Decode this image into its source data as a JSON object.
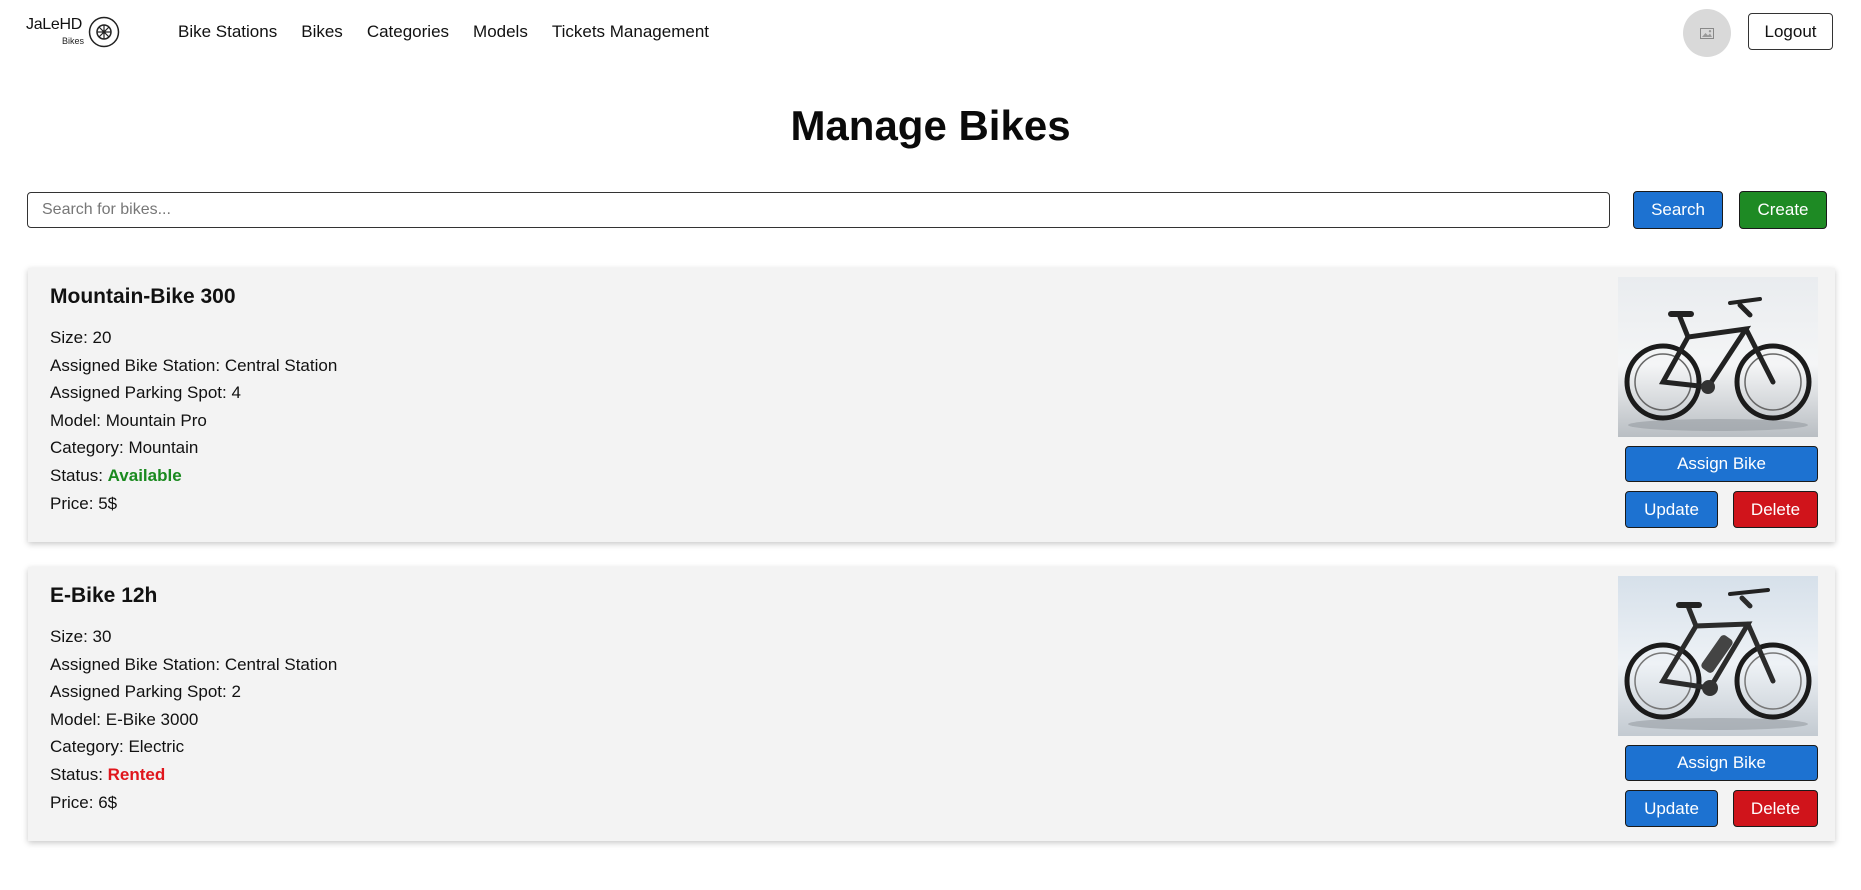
{
  "header": {
    "logo_text": "JaLeHD",
    "logo_sub": "Bikes",
    "nav": [
      "Bike Stations",
      "Bikes",
      "Categories",
      "Models",
      "Tickets Management"
    ],
    "logout_label": "Logout"
  },
  "page": {
    "title": "Manage Bikes"
  },
  "search": {
    "placeholder": "Search for bikes...",
    "value": "",
    "search_label": "Search",
    "create_label": "Create"
  },
  "bikes": [
    {
      "name": "Mountain-Bike 300",
      "size_label": "Size: ",
      "size": "20",
      "station_label": "Assigned Bike Station: ",
      "station": "Central Station",
      "spot_label": "Assigned Parking Spot: ",
      "spot": "4",
      "model_label": "Model: ",
      "model": "Mountain Pro",
      "category_label": "Category: ",
      "category": "Mountain",
      "status_label": "Status: ",
      "status": "Available",
      "price_label": "Price: ",
      "price": "5$",
      "assign_label": "Assign Bike",
      "update_label": "Update",
      "delete_label": "Delete"
    },
    {
      "name": "E-Bike 12h",
      "size_label": "Size: ",
      "size": "30",
      "station_label": "Assigned Bike Station: ",
      "station": "Central Station",
      "spot_label": "Assigned Parking Spot: ",
      "spot": "2",
      "model_label": "Model: ",
      "model": "E-Bike 3000",
      "category_label": "Category: ",
      "category": "Electric",
      "status_label": "Status: ",
      "status": "Rented",
      "price_label": "Price: ",
      "price": "6$",
      "assign_label": "Assign Bike",
      "update_label": "Update",
      "delete_label": "Delete"
    }
  ],
  "colors": {
    "primary_blue": "#1d72d1",
    "create_green": "#1e8a24",
    "delete_red": "#d0141b",
    "status_available": "#1a8a1f",
    "status_rented": "#e0161c"
  },
  "icons": {
    "logo": "bicycle-wheel-icon",
    "avatar": "image-placeholder-icon"
  }
}
